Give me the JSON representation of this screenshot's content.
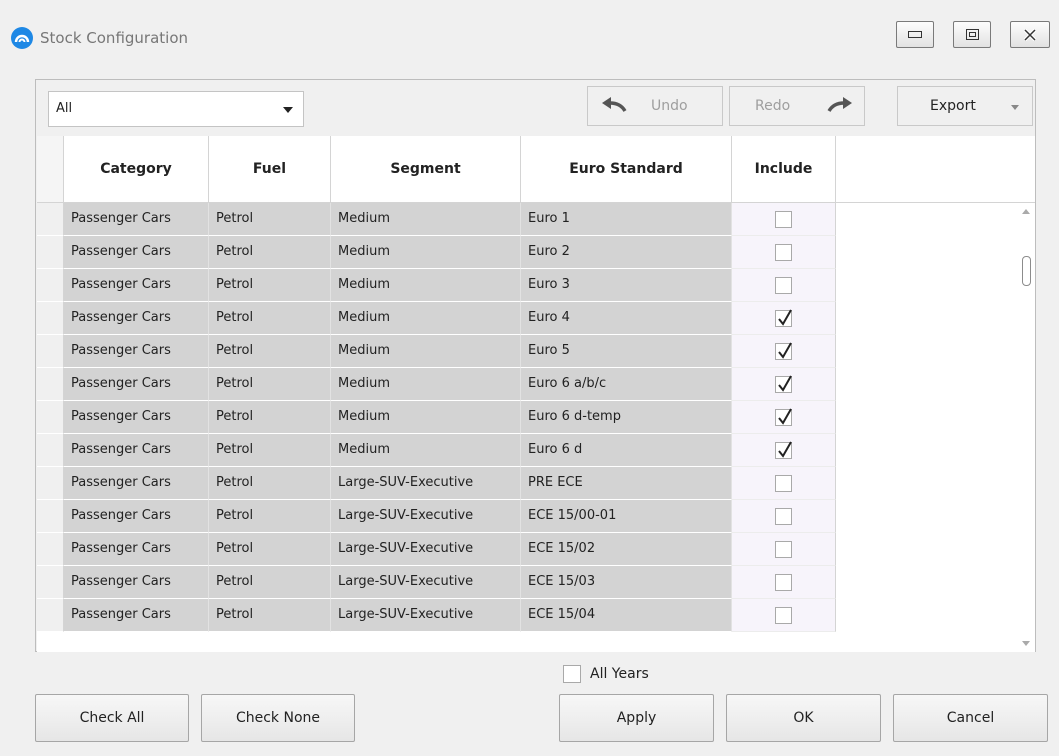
{
  "window": {
    "title": "Stock Configuration"
  },
  "toolbar": {
    "filter_value": "All",
    "undo_label": "Undo",
    "redo_label": "Redo",
    "export_label": "Export"
  },
  "grid": {
    "columns": [
      "Category",
      "Fuel",
      "Segment",
      "Euro Standard",
      "Include"
    ],
    "rows": [
      {
        "category": "Passenger Cars",
        "fuel": "Petrol",
        "segment": "Medium",
        "euro": "Euro 1",
        "include": false
      },
      {
        "category": "Passenger Cars",
        "fuel": "Petrol",
        "segment": "Medium",
        "euro": "Euro 2",
        "include": false
      },
      {
        "category": "Passenger Cars",
        "fuel": "Petrol",
        "segment": "Medium",
        "euro": "Euro 3",
        "include": false
      },
      {
        "category": "Passenger Cars",
        "fuel": "Petrol",
        "segment": "Medium",
        "euro": "Euro 4",
        "include": true
      },
      {
        "category": "Passenger Cars",
        "fuel": "Petrol",
        "segment": "Medium",
        "euro": "Euro 5",
        "include": true
      },
      {
        "category": "Passenger Cars",
        "fuel": "Petrol",
        "segment": "Medium",
        "euro": "Euro 6 a/b/c",
        "include": true
      },
      {
        "category": "Passenger Cars",
        "fuel": "Petrol",
        "segment": "Medium",
        "euro": "Euro 6 d-temp",
        "include": true
      },
      {
        "category": "Passenger Cars",
        "fuel": "Petrol",
        "segment": "Medium",
        "euro": "Euro 6 d",
        "include": true
      },
      {
        "category": "Passenger Cars",
        "fuel": "Petrol",
        "segment": "Large-SUV-Executive",
        "euro": "PRE ECE",
        "include": false
      },
      {
        "category": "Passenger Cars",
        "fuel": "Petrol",
        "segment": "Large-SUV-Executive",
        "euro": "ECE 15/00-01",
        "include": false
      },
      {
        "category": "Passenger Cars",
        "fuel": "Petrol",
        "segment": "Large-SUV-Executive",
        "euro": "ECE 15/02",
        "include": false
      },
      {
        "category": "Passenger Cars",
        "fuel": "Petrol",
        "segment": "Large-SUV-Executive",
        "euro": "ECE 15/03",
        "include": false
      },
      {
        "category": "Passenger Cars",
        "fuel": "Petrol",
        "segment": "Large-SUV-Executive",
        "euro": "ECE 15/04",
        "include": false
      }
    ]
  },
  "footer": {
    "all_years_label": "All Years",
    "all_years_checked": false,
    "check_all_label": "Check All",
    "check_none_label": "Check None",
    "apply_label": "Apply",
    "ok_label": "OK",
    "cancel_label": "Cancel"
  },
  "colors": {
    "readonly_cell": "#d3d3d3",
    "include_cell": "#f7f4fb",
    "app_icon": "#1e88e5"
  }
}
